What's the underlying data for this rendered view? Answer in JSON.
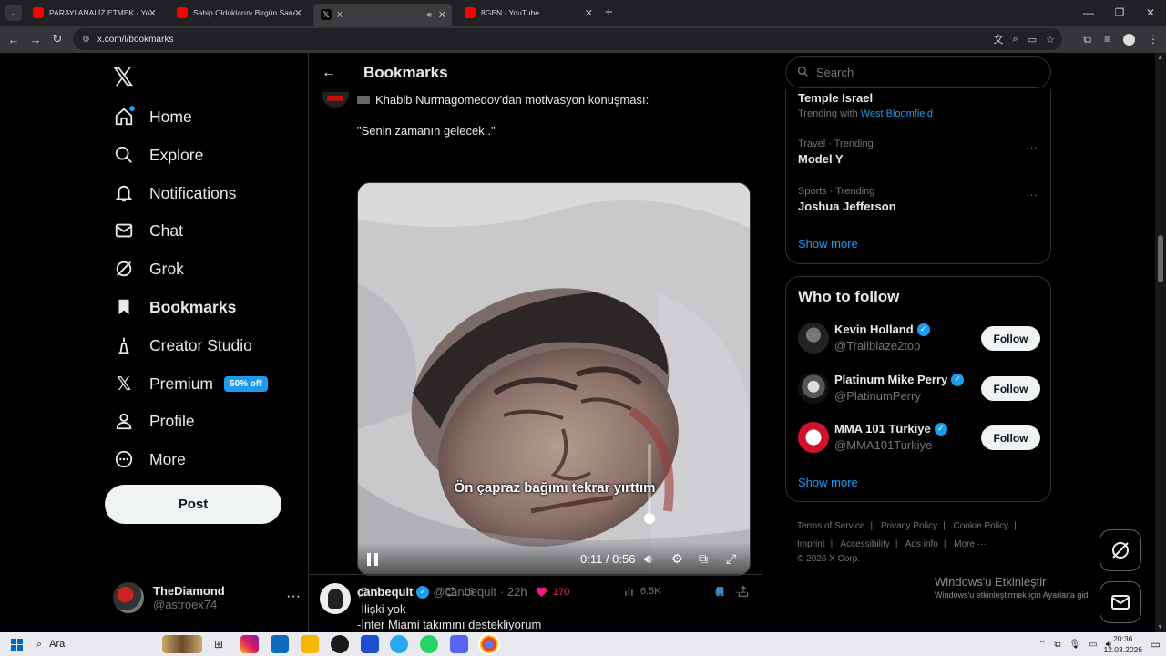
{
  "browser": {
    "tabs": [
      {
        "title": "PARAYI ANALİZ ETMEK - YouTu",
        "favicon": "youtube-icon"
      },
      {
        "title": "Sahip Olduklarını Birgün Sana S",
        "favicon": "youtube-icon"
      },
      {
        "title": "X",
        "favicon": "x-icon",
        "active": true
      },
      {
        "title": "8GEN - YouTube",
        "favicon": "youtube-icon"
      }
    ],
    "url": "x.com/i/bookmarks"
  },
  "nav": {
    "items": [
      {
        "label": "Home",
        "icon": "home-icon"
      },
      {
        "label": "Explore",
        "icon": "search-icon"
      },
      {
        "label": "Notifications",
        "icon": "bell-icon"
      },
      {
        "label": "Chat",
        "icon": "mail-icon"
      },
      {
        "label": "Grok",
        "icon": "grok-icon"
      },
      {
        "label": "Bookmarks",
        "icon": "bookmark-icon",
        "active": true
      },
      {
        "label": "Creator Studio",
        "icon": "creator-studio-icon"
      },
      {
        "label": "Premium",
        "icon": "x-icon",
        "badge": "50% off"
      },
      {
        "label": "Profile",
        "icon": "person-icon"
      },
      {
        "label": "More",
        "icon": "more-circle-icon"
      }
    ],
    "post_label": "Post",
    "account": {
      "name": "TheDiamond",
      "handle": "@astroex74"
    }
  },
  "main": {
    "title": "Bookmarks",
    "tweet1": {
      "text_line1": "Khabib Nurmagomedov'dan motivasyon konuşması:",
      "text_line2": "\"Senin zamanın gelecek..\"",
      "video": {
        "subtitle": "Ön çapraz bağımı tekrar yırttım",
        "time": "0:11 / 0:56"
      },
      "stats": {
        "replies": "2",
        "reposts": "15",
        "likes": "170",
        "views": "6.5K"
      }
    },
    "tweet2": {
      "name": "canbequit",
      "handle": "@canbequit",
      "time": "· 22h",
      "line1": "-İlişki yok",
      "line2": "-İnter Miami takımını destekliyorum"
    }
  },
  "right": {
    "search_placeholder": "Search",
    "trends": [
      {
        "meta": "",
        "name": "Temple Israel",
        "trending_with_prefix": "Trending with",
        "trending_with_link": "West Bloomfield"
      },
      {
        "meta": "Travel · Trending",
        "name": "Model Y"
      },
      {
        "meta": "Sports · Trending",
        "name": "Joshua Jefferson"
      }
    ],
    "trends_show_more": "Show more",
    "who_to_follow": {
      "title": "Who to follow",
      "accounts": [
        {
          "name": "Kevin Holland",
          "handle": "@Trailblaze2top",
          "button": "Follow"
        },
        {
          "name": "Platinum Mike Perry",
          "handle": "@PlatinumPerry",
          "button": "Follow"
        },
        {
          "name": "MMA 101 Türkiye",
          "handle": "@MMA101Turkiye",
          "button": "Follow"
        }
      ],
      "show_more": "Show more"
    },
    "footer": {
      "links": [
        "Terms of Service",
        "|",
        "Privacy Policy",
        "|",
        "Cookie Policy",
        "|"
      ],
      "links2": [
        "Imprint",
        "|",
        "Accessibility",
        "|",
        "Ads info",
        "|",
        "More ···"
      ],
      "copyright": "© 2026 X Corp."
    }
  },
  "windows": {
    "activate_title": "Windows'u Etkinleştir",
    "activate_sub": "Windows'u etkinleştirmek için Ayarlar'a gidi",
    "search_label": "Ara",
    "time": "20:36",
    "date": "12.03.2026"
  },
  "colors": {
    "accent": "#1d9bf0",
    "like": "#f91880",
    "background": "#000000",
    "border": "#2f3336"
  }
}
